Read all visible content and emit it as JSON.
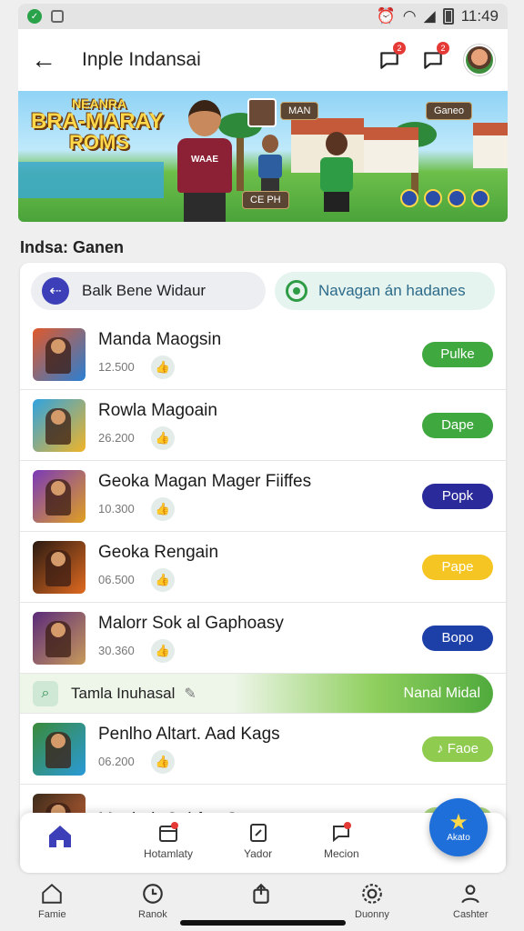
{
  "status_bar": {
    "time": "11:49"
  },
  "header": {
    "title": "Inple Indansai",
    "badge_1": "2",
    "badge_2": "2"
  },
  "banner": {
    "logo_line1": "NEANRA",
    "logo_line2": "BRA-MARAY",
    "logo_line3": "ROMS",
    "shirt_text": "WAAE",
    "sign_top": "MAN",
    "sign_right": "Ganeo",
    "sign_bottom": "CE PH"
  },
  "section_title": "Indsa: Ganen",
  "filters": {
    "left_label": "Balk Bene Widaur",
    "right_label": "Navagan án hadanes"
  },
  "apps": [
    {
      "name": "Manda Maogsin",
      "size": "12.500",
      "button": "Pulke",
      "button_color": "#3fa83e",
      "thumb_colors": [
        "#e0582a",
        "#2a7fd4"
      ]
    },
    {
      "name": "Rowla Magoain",
      "size": "26.200",
      "button": "Dape",
      "button_color": "#3fa83e",
      "thumb_colors": [
        "#2fa3e0",
        "#f0b428"
      ]
    },
    {
      "name": "Geoka Magan Mager Fiiffes",
      "size": "10.300",
      "button": "Popk",
      "button_color": "#2a2a9a",
      "thumb_colors": [
        "#7a3ab8",
        "#e0a020"
      ]
    },
    {
      "name": "Geoka Rengain",
      "size": "06.500",
      "button": "Pape",
      "button_color": "#f5c623",
      "thumb_colors": [
        "#2a1a12",
        "#e06a20"
      ]
    },
    {
      "name": "Malorr Sok al Gaphoasy",
      "size": "30.360",
      "button": "Bopo",
      "button_color": "#1d3fa8",
      "thumb_colors": [
        "#5a2a7a",
        "#c89a5a"
      ]
    }
  ],
  "promo": {
    "label": "Tamla Inuhasal",
    "action": "Nanal Midal"
  },
  "apps_after": [
    {
      "name": "Penlho Altart. Aad Kags",
      "size": "06.200",
      "button": "♪ Faoe",
      "button_color": "#8fcb4e",
      "thumb_colors": [
        "#3a8a3a",
        "#2a9ad8"
      ]
    },
    {
      "name": "Manbeh Cahfan Sapp",
      "size": "",
      "button": "",
      "button_color": "#8fcb4e",
      "thumb_colors": [
        "#3a2a1a",
        "#d46a3a"
      ]
    }
  ],
  "bottom_nav": {
    "item_1": "Hotamlaty",
    "item_2": "Yador",
    "item_3": "Mecion",
    "fab_label": "Akato"
  },
  "system_nav": {
    "item_1": "Famie",
    "item_2": "Ranok",
    "item_3": "Duonny",
    "item_4": "Cashter"
  }
}
